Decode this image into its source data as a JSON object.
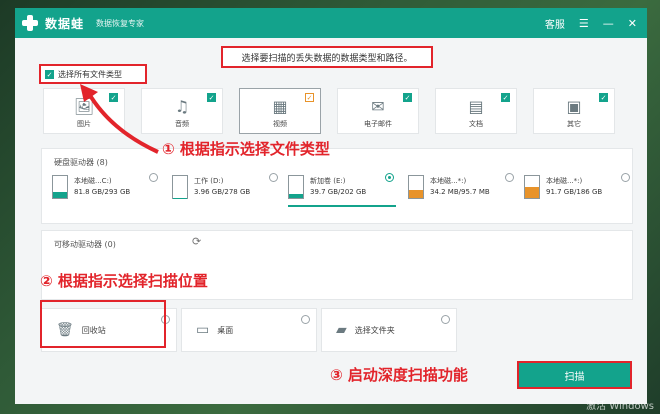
{
  "titlebar": {
    "brand": "数据蛙",
    "tagline": "数据恢复专家",
    "service": "客服"
  },
  "instruction": "选择要扫描的丢失数据的数据类型和路径。",
  "select_all": "选择所有文件类型",
  "file_types": [
    {
      "label": "图片",
      "icon": "image-icon",
      "glyph": "🖼"
    },
    {
      "label": "音频",
      "icon": "music-icon",
      "glyph": "♫"
    },
    {
      "label": "视频",
      "icon": "video-icon",
      "glyph": "▦"
    },
    {
      "label": "电子邮件",
      "icon": "email-icon",
      "glyph": "✉"
    },
    {
      "label": "文档",
      "icon": "document-icon",
      "glyph": "▤"
    },
    {
      "label": "其它",
      "icon": "grid-icon",
      "glyph": "▣"
    }
  ],
  "hard_drives": {
    "title": "硬盘驱动器",
    "count": "(8)",
    "drives": [
      {
        "name": "本地磁...C:)",
        "size": "81.8 GB/293 GB",
        "used": 0.28,
        "warn": false
      },
      {
        "name": "工作 (D:)",
        "size": "3.96 GB/278 GB",
        "used": 0.02,
        "warn": false
      },
      {
        "name": "新加卷 (E:)",
        "size": "39.7 GB/202 GB",
        "used": 0.2,
        "warn": false
      },
      {
        "name": "本地磁...*:)",
        "size": "34.2 MB/95.7 MB",
        "used": 0.36,
        "warn": true
      },
      {
        "name": "本地磁...*:)",
        "size": "91.7 GB/186 GB",
        "used": 0.49,
        "warn": true
      }
    ]
  },
  "removable": {
    "title": "可移动驱动器",
    "count": "(0)"
  },
  "locations": [
    {
      "label": "回收站",
      "icon": "recycle-bin-icon"
    },
    {
      "label": "桌面",
      "icon": "desktop-icon"
    },
    {
      "label": "选择文件夹",
      "icon": "folder-icon"
    }
  ],
  "scan_button": "扫描",
  "annotations": {
    "step1": "① 根据指示选择文件类型",
    "step2": "② 根据指示选择扫描位置",
    "step3": "③ 启动深度扫描功能"
  },
  "watermark": "激活 Windows",
  "colors": {
    "accent": "#13a38c",
    "highlight": "#e2242b",
    "warning": "#e8932a"
  }
}
